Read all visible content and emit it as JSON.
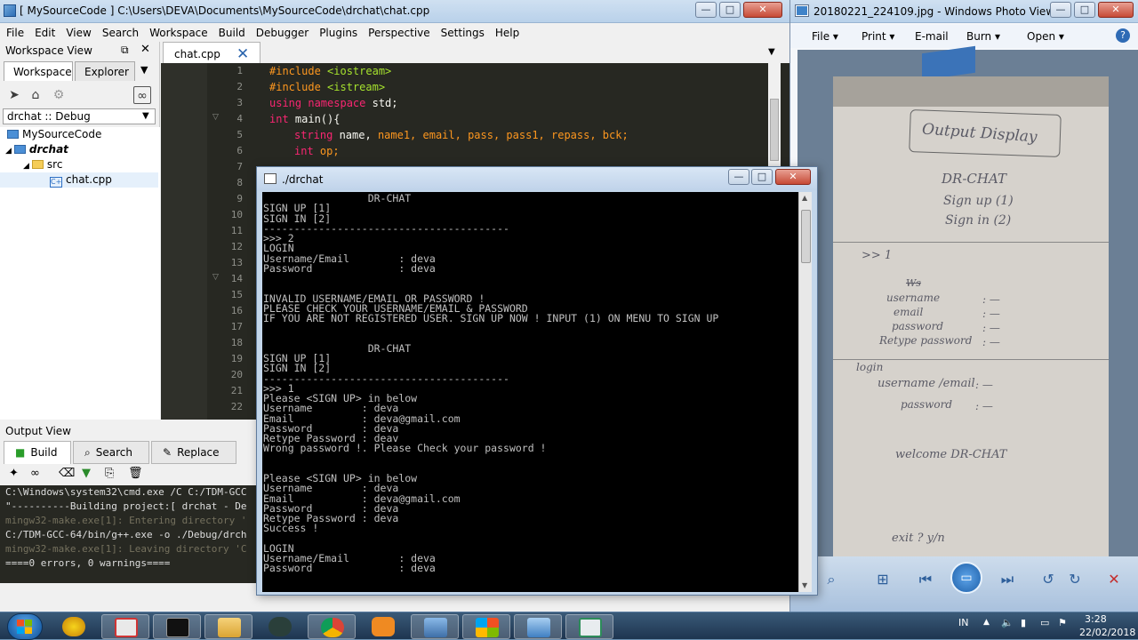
{
  "codelite": {
    "title": "[ MySourceCode ] C:\\Users\\DEVA\\Documents\\MySourceCode\\drchat\\chat.cpp",
    "menu": [
      "File",
      "Edit",
      "View",
      "Search",
      "Workspace",
      "Build",
      "Debugger",
      "Plugins",
      "Perspective",
      "Settings",
      "Help"
    ],
    "workspace_view": {
      "header": "Workspace View",
      "tabs": [
        "Workspace",
        "Explorer"
      ],
      "config": "drchat :: Debug",
      "tree": [
        "MySourceCode",
        "drchat",
        "src",
        "chat.cpp"
      ]
    },
    "editor": {
      "tab_label": "chat.cpp",
      "line_numbers": [
        "1",
        "2",
        "3",
        "4",
        "5",
        "6",
        "7",
        "8",
        "9",
        "10",
        "11",
        "12",
        "13",
        "14",
        "15",
        "16",
        "17",
        "18",
        "19",
        "20",
        "21",
        "22"
      ],
      "code": {
        "l1_a": "#include ",
        "l1_b": "<iostream>",
        "l2_a": "#include ",
        "l2_b": "<istream>",
        "l3_a": "using namespace",
        "l3_b": " std;",
        "l4_a": "int",
        "l4_b": " main(){",
        "l5_a": "string",
        "l5_b": " name, ",
        "l5_c": "name1, email, pass, pass1, repass, bck;",
        "l6_a": "int",
        "l6_b": " op;",
        "l8": "m",
        "l9": "c",
        "l10": "c",
        "l11": "c",
        "l12": "c",
        "l13": "c",
        "l14": "s"
      }
    },
    "output_view": {
      "header": "Output View",
      "tabs": [
        "Build",
        "Search",
        "Replace"
      ],
      "lines": [
        "C:\\Windows\\system32\\cmd.exe /C C:/TDM-GCC",
        "\"----------Building project:[ drchat - De",
        "mingw32-make.exe[1]: Entering directory '",
        "C:/TDM-GCC-64/bin/g++.exe -o ./Debug/drch",
        "mingw32-make.exe[1]: Leaving directory 'C",
        "====0 errors, 0 warnings===="
      ]
    }
  },
  "console": {
    "title": "./drchat",
    "lines": [
      "                 DR-CHAT",
      "SIGN UP [1]",
      "SIGN IN [2]",
      "----------------------------------------",
      ">>> 2",
      "LOGIN",
      "Username/Email        : deva",
      "Password              : deva",
      "",
      "",
      "INVALID USERNAME/EMAIL OR PASSWORD !",
      "PLEASE CHECK YOUR USERNAME/EMAIL & PASSWORD",
      "IF YOU ARE NOT REGISTERED USER. SIGN UP NOW ! INPUT (1) ON MENU TO SIGN UP",
      "",
      "",
      "                 DR-CHAT",
      "SIGN UP [1]",
      "SIGN IN [2]",
      "----------------------------------------",
      ">>> 1",
      "Please <SIGN UP> in below",
      "Username        : deva",
      "Email           : deva@gmail.com",
      "Password        : deva",
      "Retype Password : deav",
      "Wrong password !. Please Check your password !",
      "",
      "",
      "Please <SIGN UP> in below",
      "Username        : deva",
      "Email           : deva@gmail.com",
      "Password        : deva",
      "Retype Password : deva",
      "Success !",
      "",
      "LOGIN",
      "Username/Email        : deva",
      "Password              : deva"
    ]
  },
  "photo_viewer": {
    "title": "20180221_224109.jpg - Windows Photo Viewer",
    "menu": [
      "File",
      "Print",
      "E-mail",
      "Burn",
      "Open"
    ],
    "handwriting": {
      "heading": "Output Display",
      "menu_title": "DR-CHAT",
      "sign_up": "Sign up (1)",
      "sign_in": "Sign in (2)",
      "prompt": ">>  1",
      "strike": "Ws",
      "username": "username",
      "email": "email",
      "password": "password",
      "retype": "Retype password",
      "login": "login",
      "username_email": "username /email",
      "password2": "password",
      "welcome": "welcome   DR-CHAT",
      "exit": "exit ?  y/n"
    }
  },
  "taskbar": {
    "lang": "IN",
    "time": "3:28",
    "date": "22/02/2018"
  }
}
